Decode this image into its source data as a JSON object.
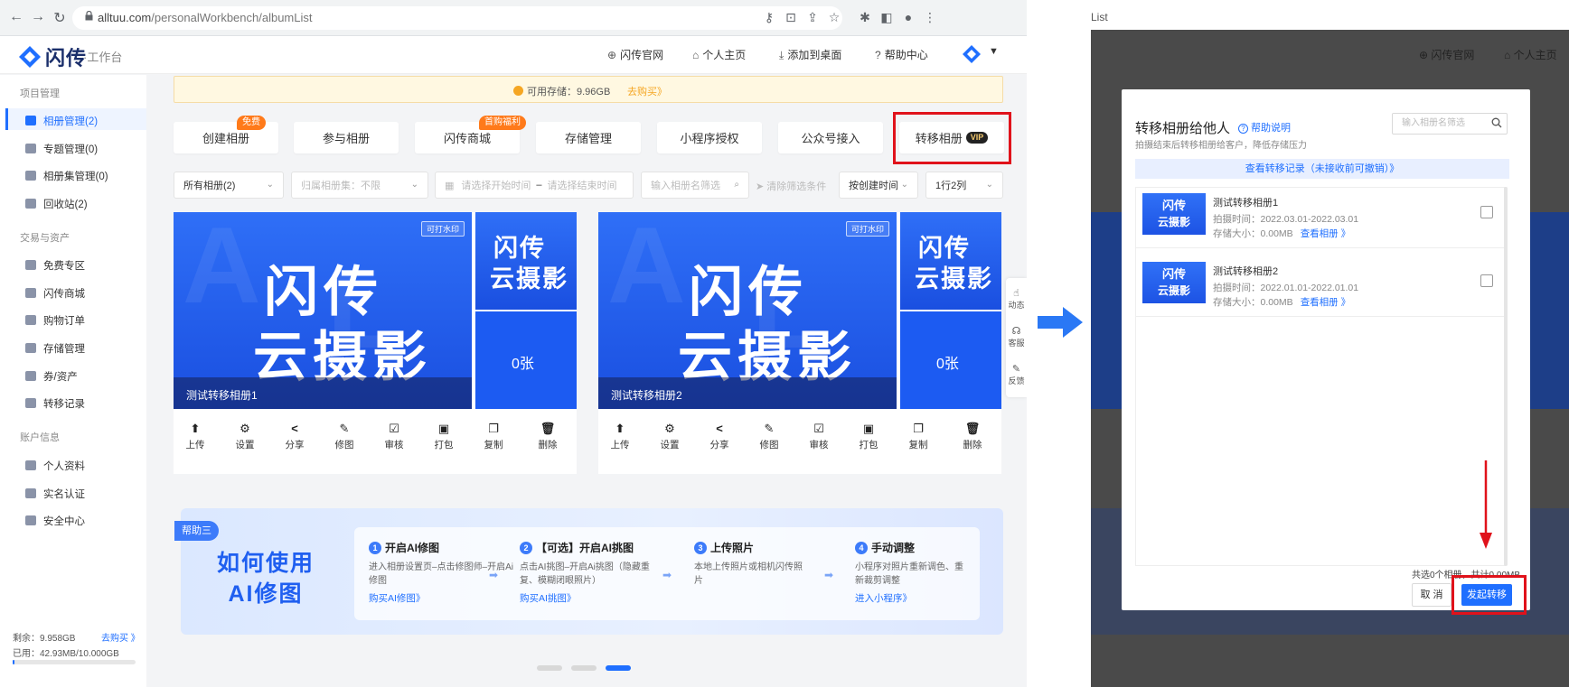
{
  "browser": {
    "url_host": "alltuu.com",
    "url_path": "/personalWorkbench/albumList"
  },
  "app": {
    "logo_text": "闪传",
    "logo_sub": "·工作台",
    "header_nav": [
      "闪传官网",
      "个人主页",
      "添加到桌面",
      "帮助中心"
    ]
  },
  "sidebar": {
    "groups": [
      {
        "title": "项目管理",
        "items": [
          "相册管理(2)",
          "专题管理(0)",
          "相册集管理(0)",
          "回收站(2)"
        ]
      },
      {
        "title": "交易与资产",
        "items": [
          "免费专区",
          "闪传商城",
          "购物订单",
          "存储管理",
          "券/资产",
          "转移记录"
        ]
      },
      {
        "title": "账户信息",
        "items": [
          "个人资料",
          "实名认证",
          "安全中心"
        ]
      }
    ],
    "remaining_label": "剩余：9.958GB",
    "buy_link": "去购买 》",
    "used_label": "已用：42.93MB/10.000GB",
    "used_fraction": 0.004
  },
  "storage_notice": {
    "text": "可用存储：9.96GB",
    "link": "去购买》"
  },
  "tabs": [
    {
      "label": "创建相册",
      "badge": "免费"
    },
    {
      "label": "参与相册",
      "badge": ""
    },
    {
      "label": "闪传商城",
      "badge": "首购福利"
    },
    {
      "label": "存储管理",
      "badge": ""
    },
    {
      "label": "小程序授权",
      "badge": ""
    },
    {
      "label": "公众号接入",
      "badge": ""
    },
    {
      "label": "转移相册",
      "badge": "VIP"
    }
  ],
  "filters": {
    "all_albums": "所有相册(2)",
    "album_set": "归属相册集：不限",
    "start_placeholder": "请选择开始时间",
    "dash": "–",
    "end_placeholder": "请选择结束时间",
    "name_placeholder": "输入相册名筛选",
    "clear": "清除筛选条件",
    "sort": "按创建时间",
    "layout": "1行2列"
  },
  "albums": [
    {
      "title": "测试转移相册1",
      "watermark": "可打水印",
      "cover_big": "闪传",
      "cover_big2": "云摄影",
      "cover_small": "闪传",
      "cover_small2": "云摄影",
      "count": "0张"
    },
    {
      "title": "测试转移相册2",
      "watermark": "可打水印",
      "cover_big": "闪传",
      "cover_big2": "云摄影",
      "cover_small": "闪传",
      "cover_small2": "云摄影",
      "count": "0张"
    }
  ],
  "album_actions": [
    "上传",
    "设置",
    "分享",
    "修图",
    "审核",
    "打包",
    "复制",
    "删除"
  ],
  "float_bar": [
    "动态",
    "客服",
    "反馈"
  ],
  "help": {
    "tag": "帮助三",
    "title_line1": "如何使用",
    "title_line2": "AI修图",
    "steps": [
      {
        "num": "1",
        "title": "开启AI修图",
        "desc": "进入相册设置页–点击修图师–开启Ai修图",
        "link": "购买AI修图》"
      },
      {
        "num": "2",
        "title": "【可选】开启AI挑图",
        "desc": "点击AI挑图–开启Ai挑图（隐藏重复、模糊闭眼照片）",
        "link": "购买AI挑图》"
      },
      {
        "num": "3",
        "title": "上传照片",
        "desc": "本地上传照片或相机闪传照片",
        "link": ""
      },
      {
        "num": "4",
        "title": "手动调整",
        "desc": "小程序对照片重新调色、重新裁剪调整",
        "link": "进入小程序》"
      }
    ]
  },
  "right_panel": {
    "top_text": "List",
    "dim_nav": [
      "闪传官网",
      "个人主页"
    ],
    "modal": {
      "title": "转移相册给他人",
      "help": "帮助说明",
      "subtitle": "拍摄结束后转移相册给客户，降低存储压力",
      "search_placeholder": "输入相册名筛选",
      "record_link": "查看转移记录（未接收前可撤销）》",
      "items": [
        {
          "thumb1": "闪传",
          "thumb2": "云摄影",
          "name": "测试转移相册1",
          "time": "拍摄时间：2022.03.01-2022.03.01",
          "size": "存储大小：0.00MB",
          "link": "查看相册 》"
        },
        {
          "thumb1": "闪传",
          "thumb2": "云摄影",
          "name": "测试转移相册2",
          "time": "拍摄时间：2022.01.01-2022.01.01",
          "size": "存储大小：0.00MB",
          "link": "查看相册 》"
        }
      ],
      "total": "共选0个相册，共计0.00MB",
      "cancel": "取 消",
      "submit": "发起转移"
    }
  },
  "colors": {
    "accent": "#1f6fff",
    "highlight": "#e0121b",
    "badge": "#ff7a1a"
  }
}
